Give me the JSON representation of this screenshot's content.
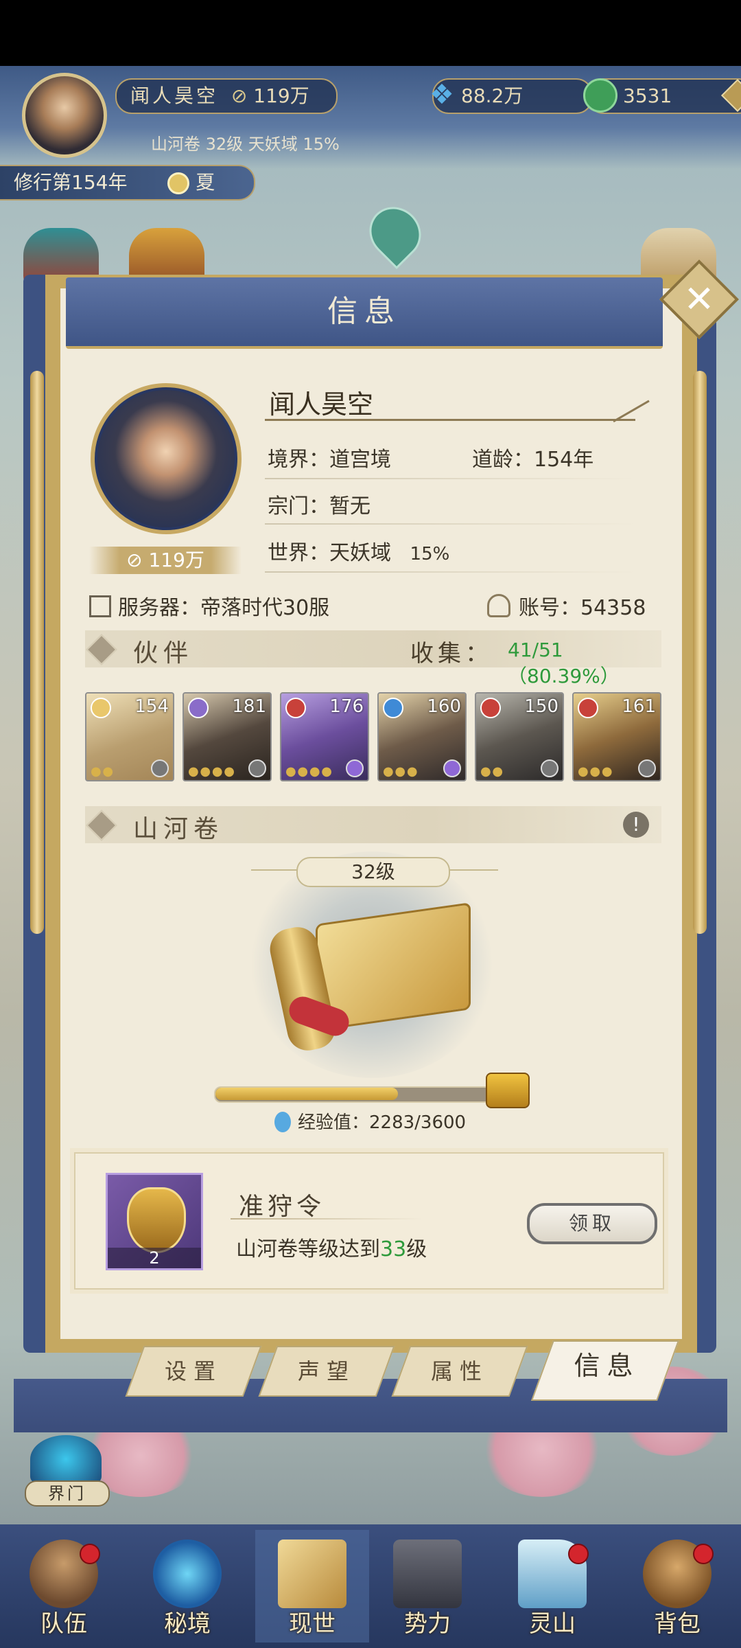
{
  "top_bar": {
    "player_name": "闻人昊空",
    "power": "119万",
    "resource_1": "88.2万",
    "resource_2": "3531",
    "scroll_info": "山河卷 32级 天妖域 15%",
    "year": "修行第154年",
    "season": "夏"
  },
  "panel": {
    "title": "信息",
    "close_label": "✕"
  },
  "profile": {
    "name": "闻人昊空",
    "realm": "境界：道宫境",
    "age": "道龄：154年",
    "sect": "宗门：暂无",
    "world": "世界：天妖域",
    "world_progress": "15%",
    "power": "119万",
    "server": "服务器：帝落时代30服",
    "account": "账号：54358"
  },
  "partners": {
    "title": "伙伴",
    "collect_label": "收集：",
    "collect_value": "41/51（80.39%）",
    "items": [
      {
        "level": "154",
        "stars": 2
      },
      {
        "level": "181",
        "stars": 4
      },
      {
        "level": "176",
        "stars": 4
      },
      {
        "level": "160",
        "stars": 3
      },
      {
        "level": "150",
        "stars": 2
      },
      {
        "level": "161",
        "stars": 3
      }
    ]
  },
  "scroll_section": {
    "title": "山河卷",
    "info_icon": "!",
    "level": "32级",
    "exp_label": "经验值：2283/3600",
    "exp_current": 2283,
    "exp_max": 3600
  },
  "task": {
    "title": "准狩令",
    "description_prefix": "山河卷等级达到",
    "description_level": "33",
    "description_suffix": "级",
    "count": "2",
    "button_label": "领取"
  },
  "tabs": [
    "设置",
    "声望",
    "属性",
    "信息"
  ],
  "side": {
    "jiemen": "界门"
  },
  "nav": [
    "队伍",
    "秘境",
    "现世",
    "势力",
    "灵山",
    "背包"
  ],
  "colors": {
    "accent_gold": "#c5a861",
    "panel_blue": "#3f5586",
    "green_text": "#2e9a3b",
    "red_dot": "#d4252d"
  }
}
